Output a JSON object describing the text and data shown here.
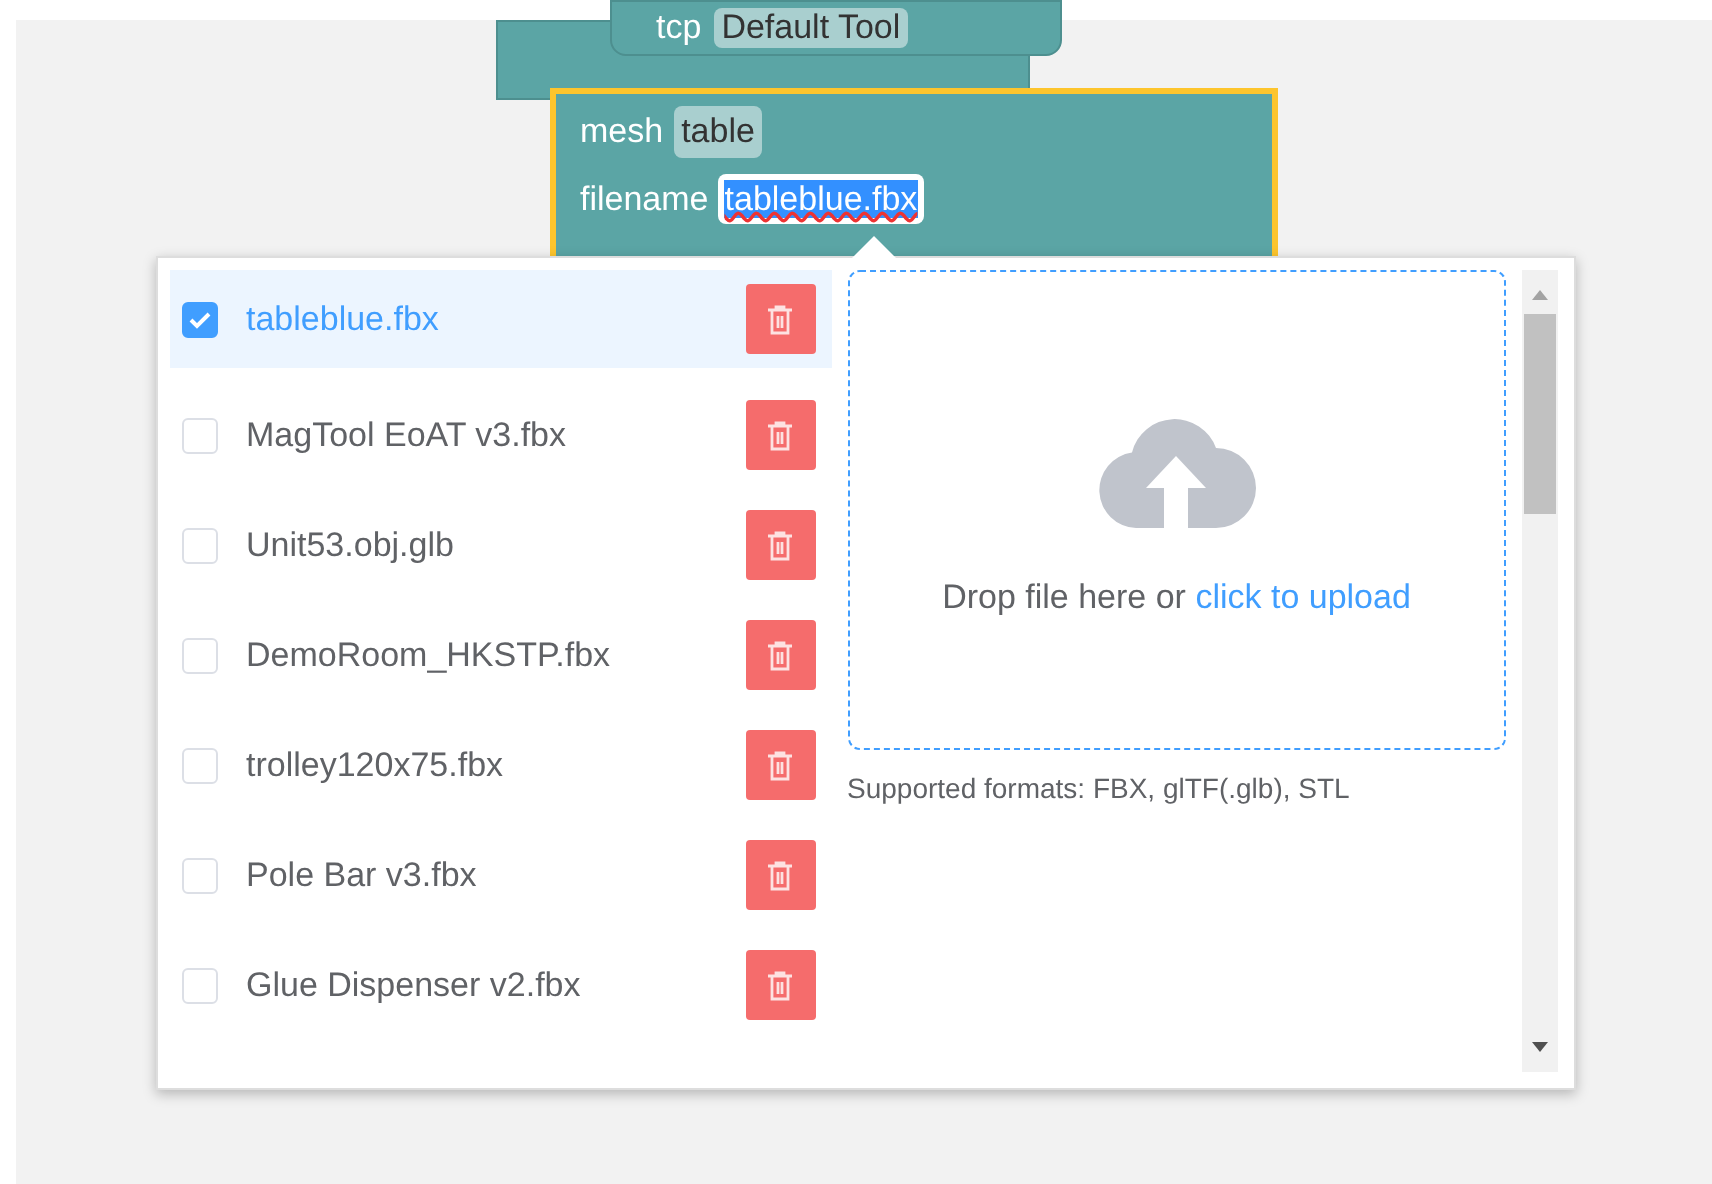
{
  "workspace": {
    "tcp_block": {
      "label": "tcp",
      "value": "Default Tool"
    },
    "mesh_block": {
      "selected": true,
      "rows": [
        {
          "label": "mesh",
          "value": "table",
          "kind": "dropdown"
        },
        {
          "label": "filename",
          "value": "tableblue.fbx",
          "kind": "text_input"
        }
      ]
    }
  },
  "file_popup": {
    "files": [
      {
        "name": "tableblue.fbx",
        "checked": true
      },
      {
        "name": "MagTool EoAT v3.fbx",
        "checked": false
      },
      {
        "name": "Unit53.obj.glb",
        "checked": false
      },
      {
        "name": "DemoRoom_HKSTP.fbx",
        "checked": false
      },
      {
        "name": "trolley120x75.fbx",
        "checked": false
      },
      {
        "name": "Pole Bar v3.fbx",
        "checked": false
      },
      {
        "name": "Glue Dispenser v2.fbx",
        "checked": false
      }
    ],
    "upload": {
      "prompt": "Drop file here or",
      "link": "click to upload",
      "note": "Supported formats: FBX, glTF(.glb), STL"
    }
  }
}
